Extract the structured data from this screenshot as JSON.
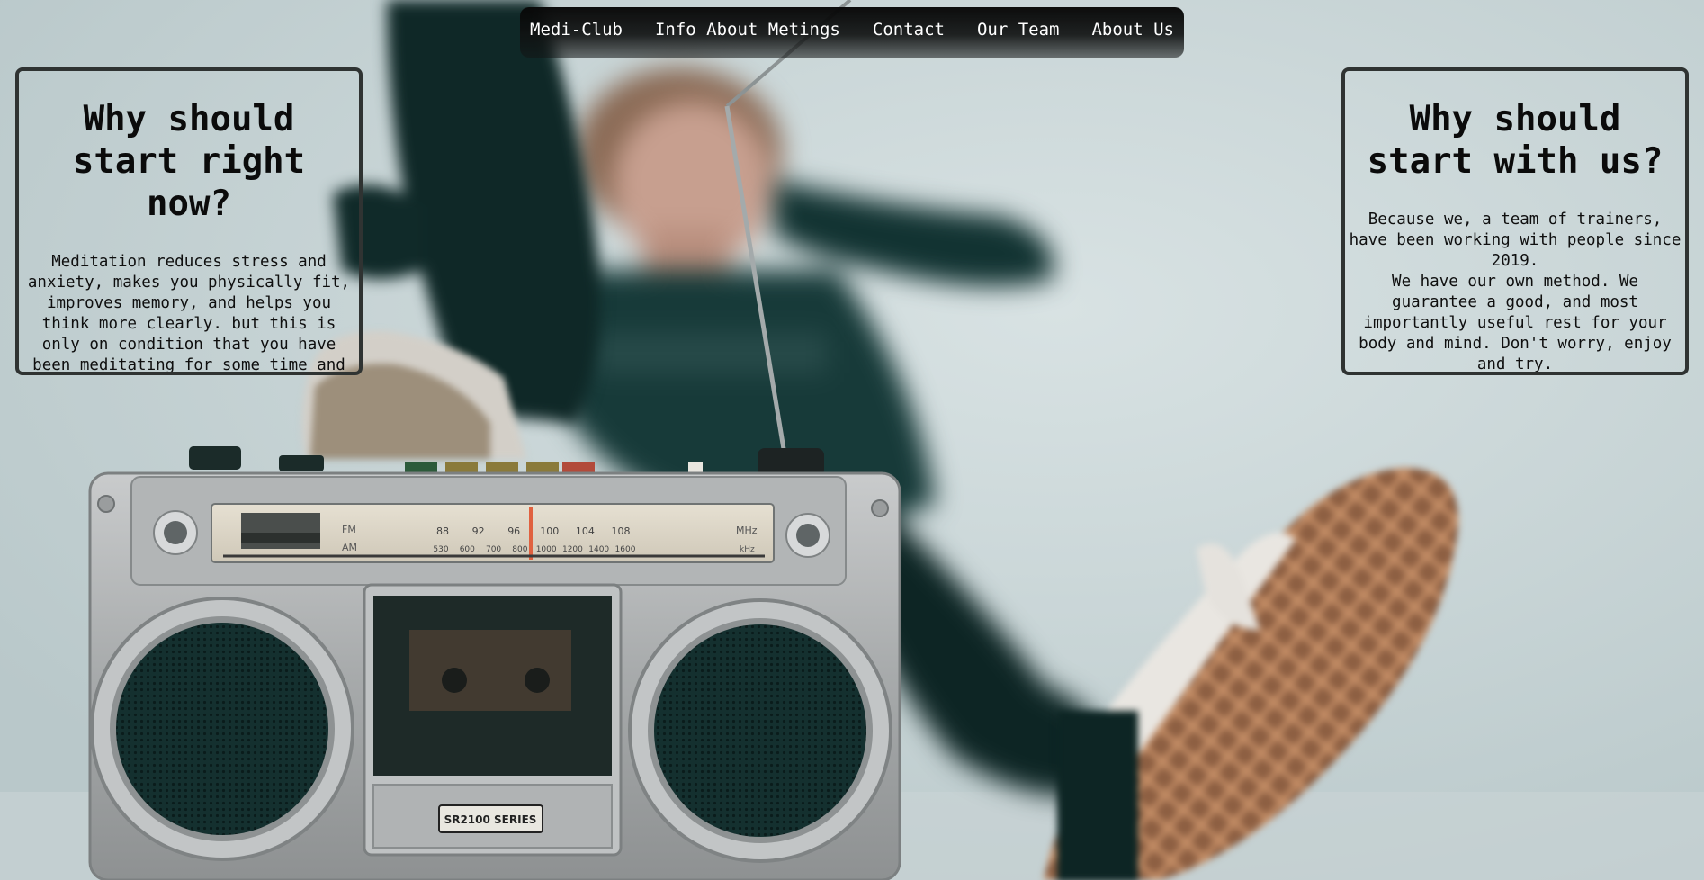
{
  "nav": {
    "items": [
      {
        "label": "Medi-Club"
      },
      {
        "label": "Info About Metings"
      },
      {
        "label": "Contact"
      },
      {
        "label": "Our Team"
      },
      {
        "label": "About Us"
      }
    ]
  },
  "left_box": {
    "title": "Why should start right now?",
    "text": "Meditation reduces stress and anxiety, makes you physically fit, improves memory, and helps you think more clearly. but this is only on condition that you have been meditating for some time and not just started, so you need to start right now."
  },
  "right_box": {
    "title": "Why should start with us?",
    "text": "Because we, a team of trainers, have been working with people since 2019.\nWe have our own method. We guarantee a good, and most importantly useful rest for your body and mind. Don't worry, enjoy and try."
  },
  "hero_image": {
    "radio_label": "SR2100 SERIES",
    "dial_fm_values": [
      "88",
      "92",
      "96",
      "100",
      "104",
      "108"
    ],
    "dial_am_values": [
      "530",
      "600",
      "700",
      "800",
      "1000",
      "1200",
      "1400",
      "1600"
    ],
    "dial_fm_unit": "MHz",
    "dial_am_unit": "kHz",
    "dial_fm_band": "FM",
    "dial_am_band": "AM"
  },
  "colors": {
    "nav_background": "#0a0a0a",
    "box_border": "#2f3332",
    "background": "#c9d5d6"
  }
}
